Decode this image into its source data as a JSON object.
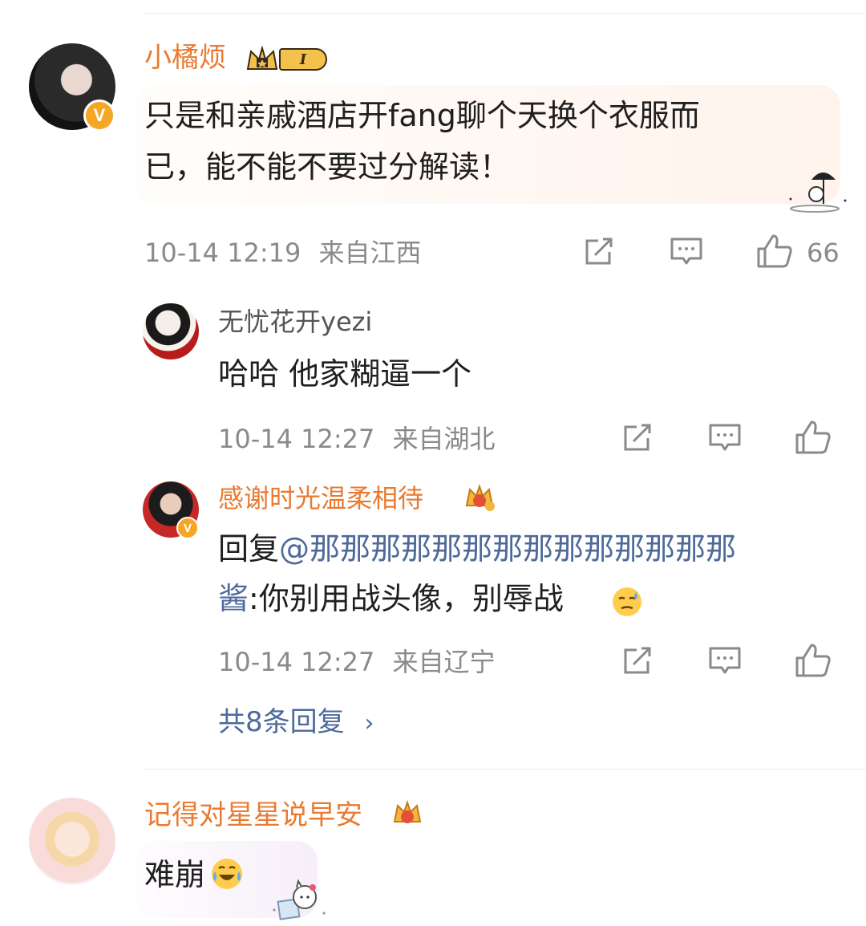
{
  "comments": [
    {
      "user": "小橘烦",
      "level_badge": "I",
      "text_line1": "只是和亲戚酒店开fang聊个天换个衣服而",
      "text_line2": "已，能不能不要过分解读！",
      "time": "10-14 12:19",
      "location": "来自江西",
      "likes": "66",
      "replies": [
        {
          "user": "无忧花开yezi",
          "text": "哈哈 他家糊逼一个",
          "time": "10-14 12:27",
          "location": "来自湖北"
        },
        {
          "user": "感谢时光温柔相待",
          "reply_prefix": "回复",
          "mention_line1": "@那那那那那那那那那那那那那那",
          "mention_line2": "酱",
          "text_rest": ":你别用战头像，别辱战",
          "time": "10-14 12:27",
          "location": "来自辽宁"
        }
      ],
      "more_replies": "共8条回复"
    },
    {
      "user": "记得对星星说早安",
      "text": "难崩"
    }
  ],
  "icons": {
    "repost": "repost-icon",
    "comment": "comment-icon",
    "like": "thumbs-up-icon",
    "verified": "verified-v-icon",
    "crown": "crown-icon",
    "emoji_sweat": "sweat-emoji-icon",
    "emoji_cry": "laugh-cry-emoji-icon"
  },
  "colors": {
    "username_orange": "#ea7a31",
    "mention_blue": "#4d6a9b",
    "meta_grey": "#8a8a8a",
    "verified_gold": "#f5a623"
  }
}
